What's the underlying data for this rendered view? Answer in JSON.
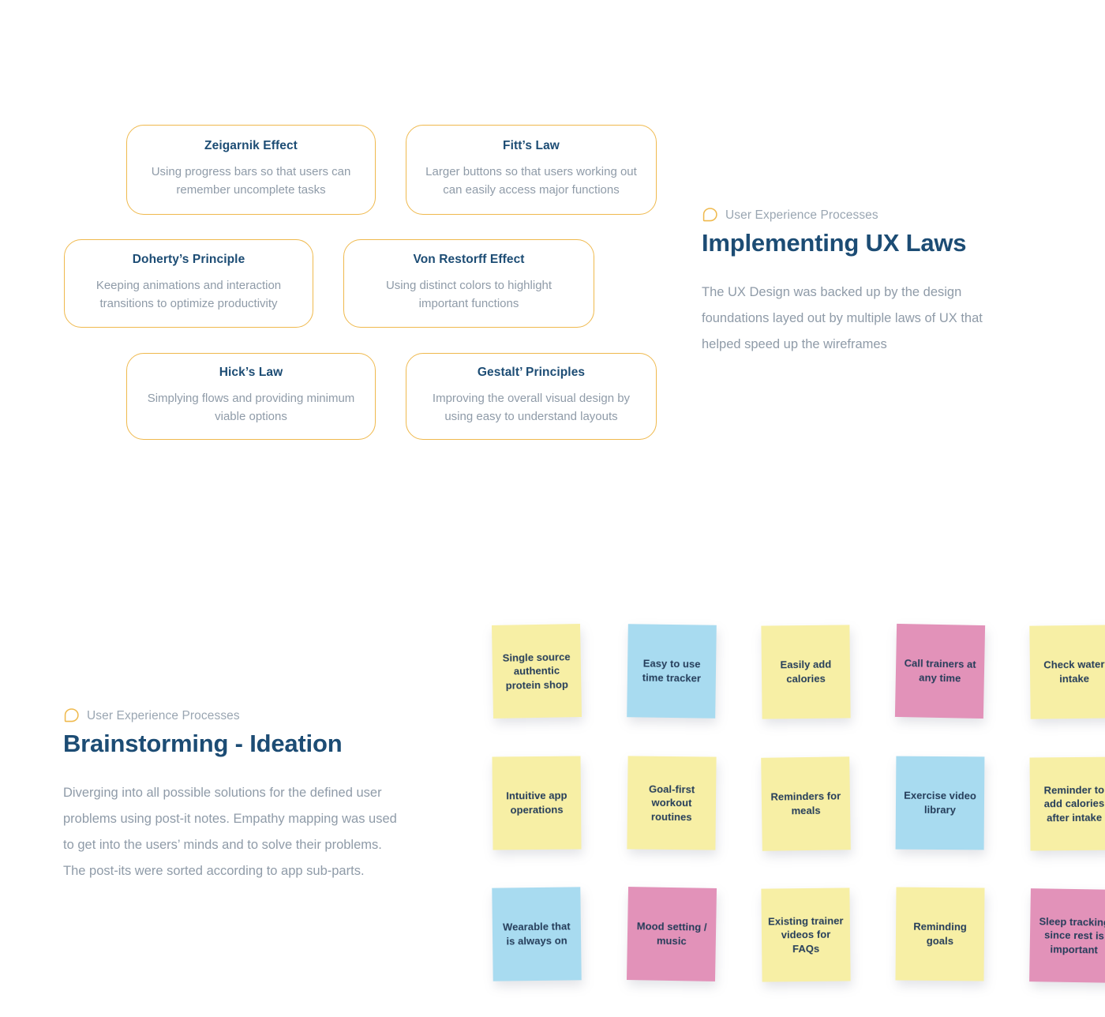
{
  "sections": [
    {
      "eyebrow": "User Experience Processes",
      "title": "Implementing UX Laws",
      "body": "The UX Design was backed up by the design foundations layed out by multiple laws of UX that helped speed up the wireframes"
    },
    {
      "eyebrow": "User Experience Processes",
      "title": "Brainstorming - Ideation",
      "body": "Diverging into all possible solutions for the defined user problems using post-it notes. Empathy mapping was used to get into the users’ minds and to solve their problems. The post-its were sorted according to app sub-parts."
    }
  ],
  "ux_laws": [
    {
      "title": "Zeigarnik Effect",
      "desc": "Using progress bars so that users can remember uncomplete tasks"
    },
    {
      "title": "Fitt’s Law",
      "desc": "Larger buttons so that users working out can easily access major functions"
    },
    {
      "title": "Doherty’s Principle",
      "desc": "Keeping animations and interaction transitions to optimize productivity"
    },
    {
      "title": "Von Restorff Effect",
      "desc": "Using distinct colors to highlight important functions"
    },
    {
      "title": "Hick’s Law",
      "desc": "Simplying flows and providing minimum viable options"
    },
    {
      "title": "Gestalt’ Principles",
      "desc": "Improving the overall visual design by using easy to understand layouts"
    }
  ],
  "notes": [
    {
      "text": "Single source authentic protein shop",
      "color": "#F7EFA5"
    },
    {
      "text": "Easy to use time tracker",
      "color": "#A8DBF0"
    },
    {
      "text": "Easily add calories",
      "color": "#F7EFA5"
    },
    {
      "text": "Call trainers at any time",
      "color": "#E292B9"
    },
    {
      "text": "Check water intake",
      "color": "#F7EFA5"
    },
    {
      "text": "Intuitive app operations",
      "color": "#F7EFA5"
    },
    {
      "text": "Goal-first workout routines",
      "color": "#F7EFA5"
    },
    {
      "text": "Reminders for meals",
      "color": "#F7EFA5"
    },
    {
      "text": "Exercise video library",
      "color": "#A8DBF0"
    },
    {
      "text": "Reminder to add calories after intake",
      "color": "#F7EFA5"
    },
    {
      "text": "Wearable that is always on",
      "color": "#A8DBF0"
    },
    {
      "text": "Mood setting / music",
      "color": "#E292B9"
    },
    {
      "text": "Existing trainer videos for FAQs",
      "color": "#F7EFA5"
    },
    {
      "text": "Reminding goals",
      "color": "#F7EFA5"
    },
    {
      "text": "Sleep tracking since rest is important",
      "color": "#E292B9"
    }
  ],
  "colors": {
    "card_border": "#EFB94D",
    "heading": "#1C4C74",
    "muted_text": "#8F9BA8",
    "note_yellow": "#F7EFA5",
    "note_blue": "#A8DBF0",
    "note_pink": "#E292B9",
    "note_text": "#243C59",
    "background": "#FFFFFF"
  },
  "icons": {
    "eyebrow": "speech-bubble-icon"
  }
}
